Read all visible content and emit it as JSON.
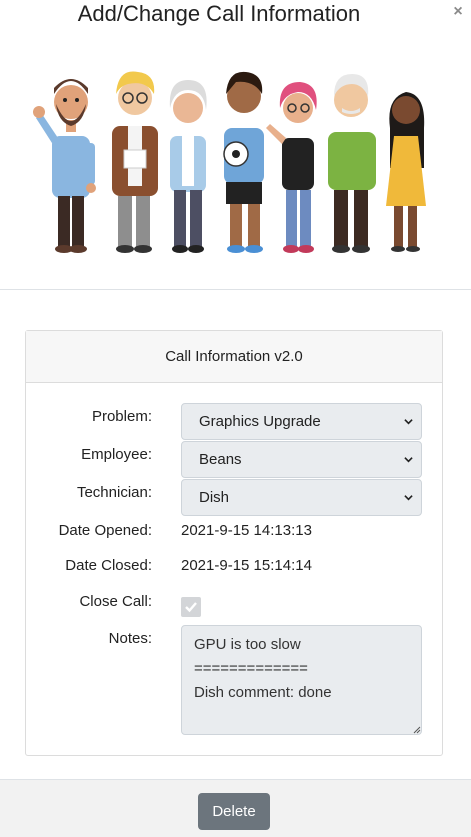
{
  "modal": {
    "title": "Add/Change Call Information",
    "close_glyph": "×",
    "hero_image": "group-of-diverse-people-illustration"
  },
  "card": {
    "header": "Call Information v2.0",
    "fields": {
      "problem": {
        "label": "Problem:",
        "selected": "Graphics Upgrade"
      },
      "employee": {
        "label": "Employee:",
        "selected": "Beans"
      },
      "technician": {
        "label": "Technician:",
        "selected": "Dish"
      },
      "date_opened": {
        "label": "Date Opened:",
        "value": "2021-9-15 14:13:13"
      },
      "date_closed": {
        "label": "Date Closed:",
        "value": "2021-9-15 15:14:14"
      },
      "close_call": {
        "label": "Close Call:",
        "checked": true,
        "disabled": true
      },
      "notes": {
        "label": "Notes:",
        "value": "GPU is too slow\n=============\nDish comment: done"
      }
    }
  },
  "footer": {
    "delete_label": "Delete"
  },
  "colors": {
    "input_bg": "#e9ecef",
    "button_bg": "#6c757d",
    "card_header_bg": "#f7f7f7"
  }
}
